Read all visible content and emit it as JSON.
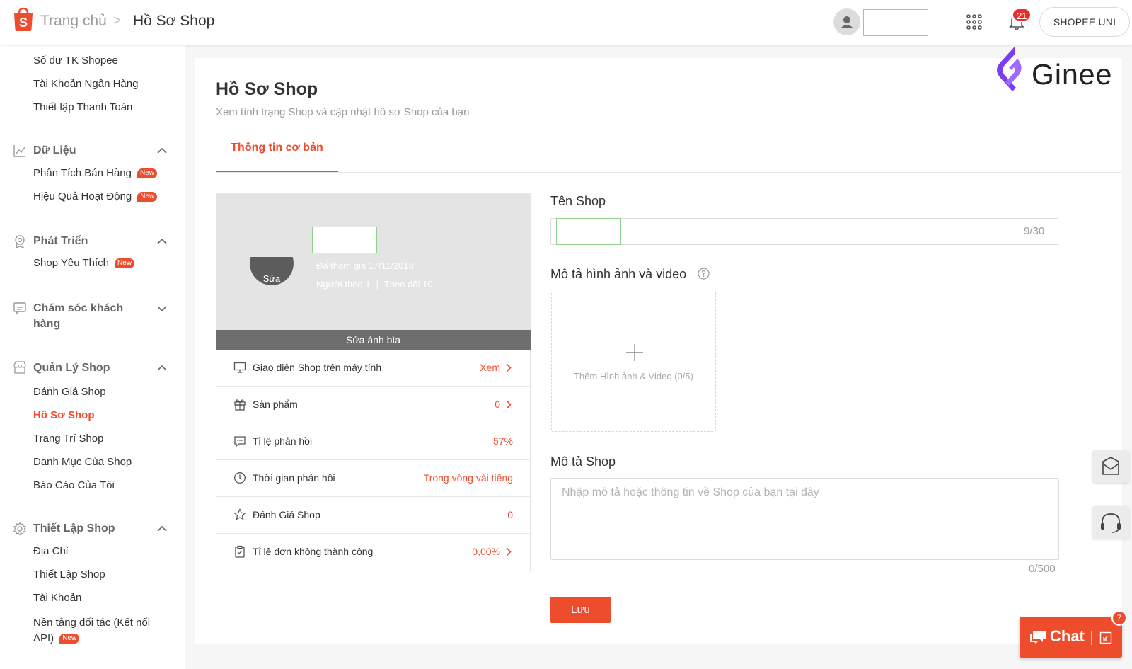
{
  "header": {
    "breadcrumb_home": "Trang chủ",
    "breadcrumb_sep": ">",
    "breadcrumb_current": "Hồ Sơ Shop",
    "notification_count": "21",
    "uni_button": "SHOPEE UNI"
  },
  "sidebar": {
    "finance_items": [
      "Số dư TK Shopee",
      "Tài Khoản Ngân Hàng",
      "Thiết lập Thanh Toán"
    ],
    "data": {
      "title": "Dữ Liệu",
      "items": [
        "Phân Tích Bán Hàng",
        "Hiệu Quả Hoạt Động"
      ]
    },
    "growth": {
      "title": "Phát Triển",
      "items": [
        "Shop Yêu Thích"
      ]
    },
    "customer_care": {
      "title_line1": "Chăm sóc khách",
      "title_line2": "hàng"
    },
    "shop_management": {
      "title": "Quản Lý Shop",
      "items": [
        "Đánh Giá Shop",
        "Hồ Sơ Shop",
        "Trang Trí Shop",
        "Danh Mục Của Shop",
        "Báo Cáo Của Tôi"
      ]
    },
    "shop_settings": {
      "title": "Thiết Lập Shop",
      "items": [
        "Địa Chỉ",
        "Thiết Lập Shop",
        "Tài Khoản"
      ],
      "partner_line1": "Nền tảng đối tác (Kết nối",
      "partner_line2": "API)"
    },
    "new_badge": "New"
  },
  "page": {
    "title": "Hồ Sơ Shop",
    "subtitle": "Xem tình trạng Shop và cập nhật hồ sơ Shop của bạn",
    "tab": "Thông tin cơ bản"
  },
  "shop_card": {
    "edit_avatar": "Sửa",
    "joined": "Đã tham gia 17/11/2018",
    "followers": "Người theo 1",
    "following": "Theo dõi 10",
    "follow_sep": "|",
    "edit_cover": "Sửa ảnh bìa",
    "stats": [
      {
        "label": "Giao diện Shop trên máy tính",
        "value": "Xem",
        "icon": "monitor-icon"
      },
      {
        "label": "Sản phẩm",
        "value": "0",
        "icon": "gift-icon"
      },
      {
        "label": "Tỉ lệ phản hồi",
        "value": "57%",
        "icon": "chat-bubble-icon"
      },
      {
        "label": "Thời gian phản hồi",
        "value": "Trong vòng vài tiếng",
        "icon": "clock-icon"
      },
      {
        "label": "Đánh Giá Shop",
        "value": "0",
        "icon": "star-icon"
      },
      {
        "label": "Tỉ lệ đơn không thành công",
        "value": "0,00%",
        "icon": "clipboard-icon"
      }
    ]
  },
  "form": {
    "shop_name_label": "Tên Shop",
    "shop_name_count": "9/30",
    "media_label": "Mô tả hình ảnh và video",
    "media_upload_text": "Thêm Hình ảnh & Video (0/5)",
    "description_label": "Mô tả Shop",
    "description_placeholder": "Nhập mô tả hoặc thông tin về Shop của bạn tại đây",
    "description_count": "0/500",
    "save": "Lưu"
  },
  "brand": {
    "ginee": "Ginee"
  },
  "chat": {
    "label": "Chat",
    "badge": "7"
  },
  "colors": {
    "accent": "#ee4d2d",
    "ginee_purple": "#7b3ff2"
  }
}
